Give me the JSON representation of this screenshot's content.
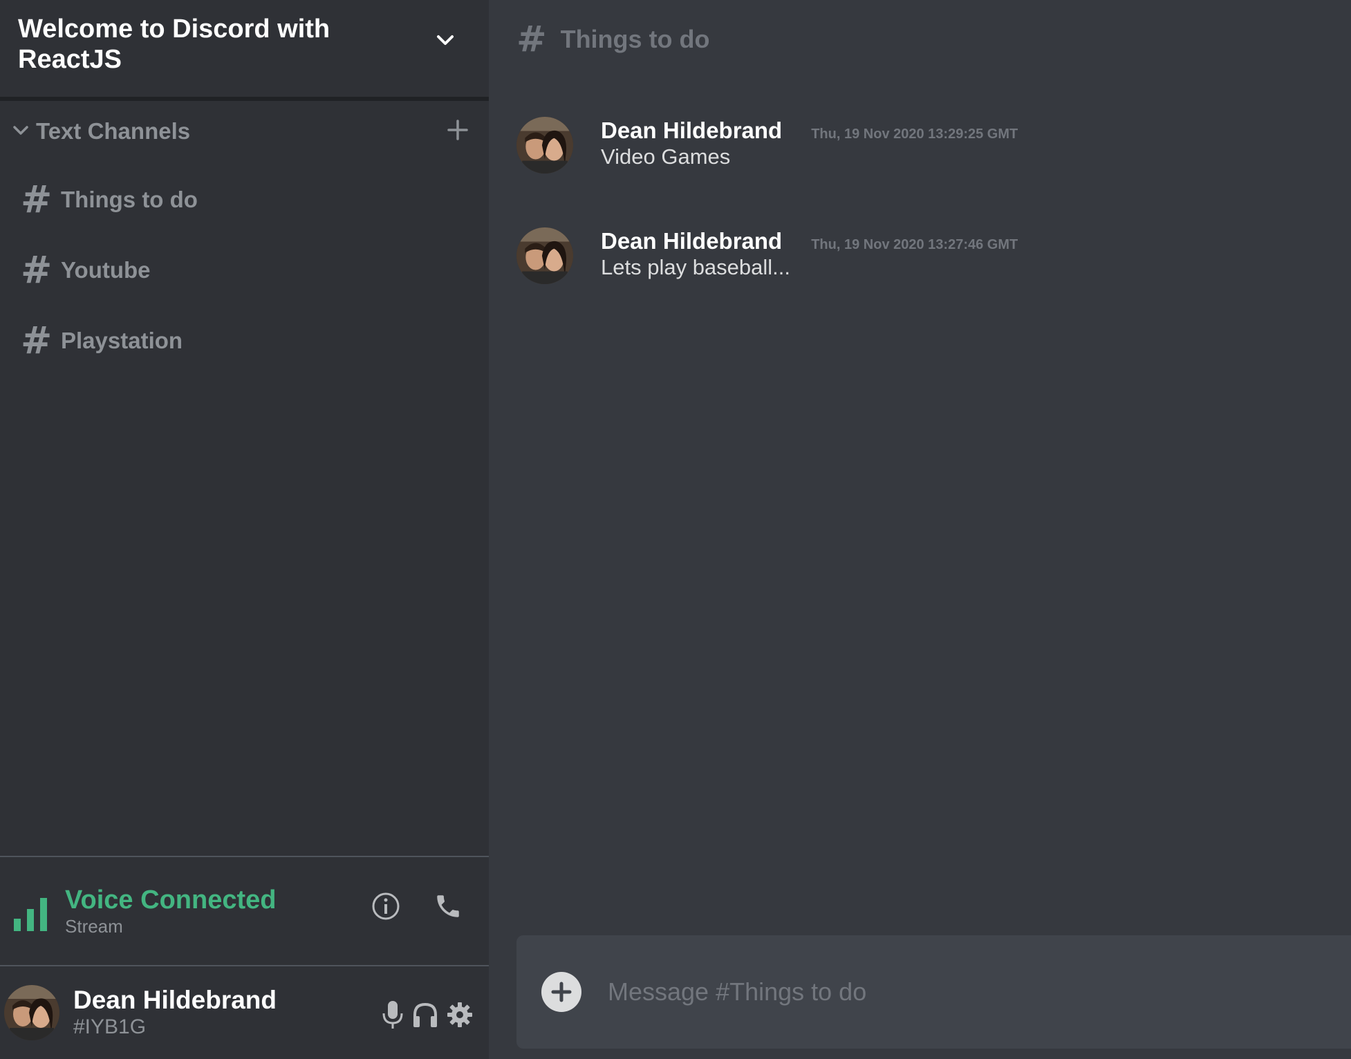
{
  "server": {
    "name": "Welcome to Discord with ReactJS",
    "dropdown_icon": "chevron-down-icon"
  },
  "channel_section": {
    "label": "Text Channels",
    "collapse_icon": "chevron-down-icon",
    "add_icon": "plus-icon"
  },
  "channels": [
    {
      "label": "Things to do",
      "icon": "hash-icon"
    },
    {
      "label": "Youtube",
      "icon": "hash-icon"
    },
    {
      "label": "Playstation",
      "icon": "hash-icon"
    }
  ],
  "voice": {
    "status": "Voice Connected",
    "sub": "Stream",
    "status_color": "#43b581",
    "info_icon": "info-icon",
    "disconnect_icon": "phone-icon"
  },
  "user": {
    "name": "Dean Hildebrand",
    "tag": "#IYB1G",
    "mic_icon": "microphone-icon",
    "headset_icon": "headphones-icon",
    "settings_icon": "gear-icon"
  },
  "chat": {
    "hash": "#",
    "title": "Things to do"
  },
  "messages": [
    {
      "author": "Dean Hildebrand",
      "time": "Thu, 19 Nov 2020 13:29:25 GMT",
      "text": "Video Games"
    },
    {
      "author": "Dean Hildebrand",
      "time": "Thu, 19 Nov 2020 13:27:46 GMT",
      "text": "Lets play baseball..."
    }
  ],
  "composer": {
    "placeholder": "Message #Things to do",
    "add_icon": "plus-circle-icon"
  },
  "colors": {
    "sidebar_bg": "#2f3136",
    "chat_bg": "#36393f",
    "composer_bg": "#40444b",
    "accent_green": "#43b581"
  }
}
